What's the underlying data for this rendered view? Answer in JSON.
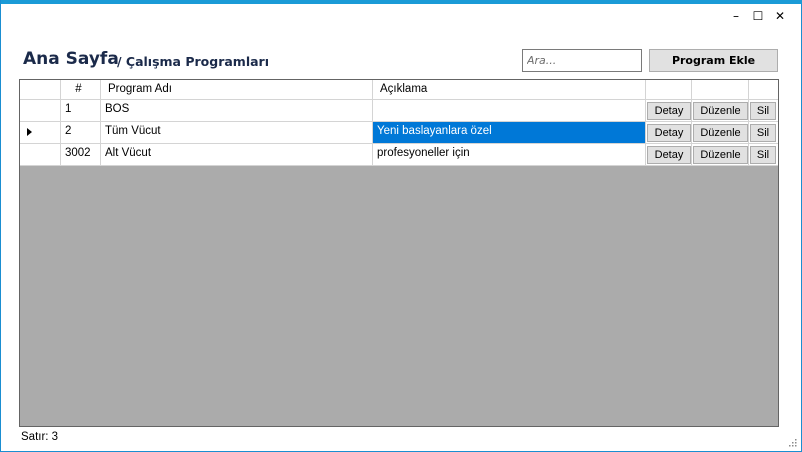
{
  "window": {
    "controls": {
      "minimize": "–",
      "maximize": "☐",
      "close": "✕"
    }
  },
  "header": {
    "title": "Ana Sayfa",
    "subtitle": "/ Çalışma Programları"
  },
  "search": {
    "placeholder": "Ara..."
  },
  "toolbar": {
    "add_label": "Program Ekle"
  },
  "grid": {
    "columns": [
      "#",
      "Program Adı",
      "Açıklama"
    ],
    "rows": [
      {
        "id": "1",
        "name": "BOS",
        "desc": "",
        "detail": "Detay",
        "edit": "Düzenle",
        "delete": "Sil"
      },
      {
        "id": "2",
        "name": "Tüm Vücut",
        "desc": "Yeni baslayanlara özel",
        "detail": "Detay",
        "edit": "Düzenle",
        "delete": "Sil"
      },
      {
        "id": "3002",
        "name": "Alt Vücut",
        "desc": "profesyoneller için",
        "detail": "Detay",
        "edit": "Düzenle",
        "delete": "Sil"
      }
    ],
    "selected_row": 1
  },
  "status": {
    "text": "Satır: 3"
  },
  "colors": {
    "accent": "#1a9bd7",
    "selection": "#0078d7",
    "grid_bg": "#ababab",
    "title": "#1b2a4a"
  }
}
